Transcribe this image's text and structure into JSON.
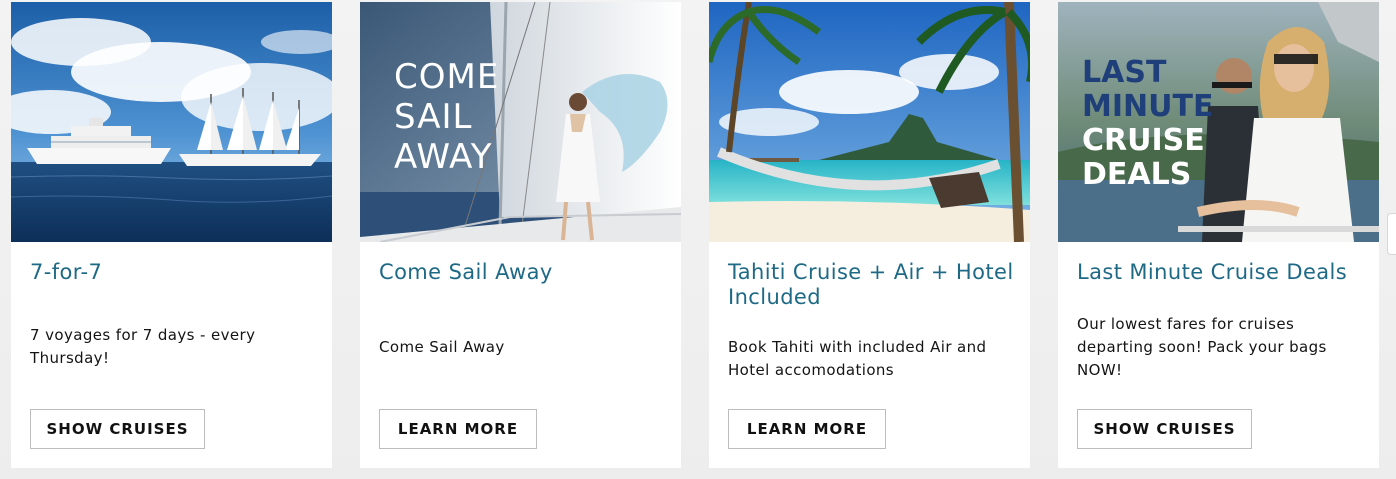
{
  "cards": [
    {
      "title": "7-for-7",
      "description": "7 voyages for 7 days - every Thursday!",
      "button": "SHOW CRUISES",
      "image_icon": "cruise-ships-at-sea-image"
    },
    {
      "title": "Come Sail Away",
      "description": "Come Sail Away",
      "button": "LEARN MORE",
      "image_icon": "woman-on-sailboat-image",
      "image_text": [
        "COME",
        "SAIL",
        "AWAY"
      ]
    },
    {
      "title": "Tahiti Cruise + Air + Hotel Included",
      "description": "Book Tahiti with included Air and Hotel accomodations",
      "button": "LEARN MORE",
      "image_icon": "tahiti-beach-hammock-image"
    },
    {
      "title": "Last Minute Cruise Deals",
      "description": "Our lowest fares for cruises departing soon! Pack your bags NOW!",
      "button": "SHOW CRUISES",
      "image_icon": "couple-on-deck-image",
      "image_text": [
        "LAST",
        "MINUTE",
        "CRUISE",
        "DEALS"
      ]
    }
  ],
  "colors": {
    "title": "#1e6a86",
    "body_text": "#141414",
    "button_border": "#bdbdbd",
    "page_background": "#f0f0f0"
  }
}
